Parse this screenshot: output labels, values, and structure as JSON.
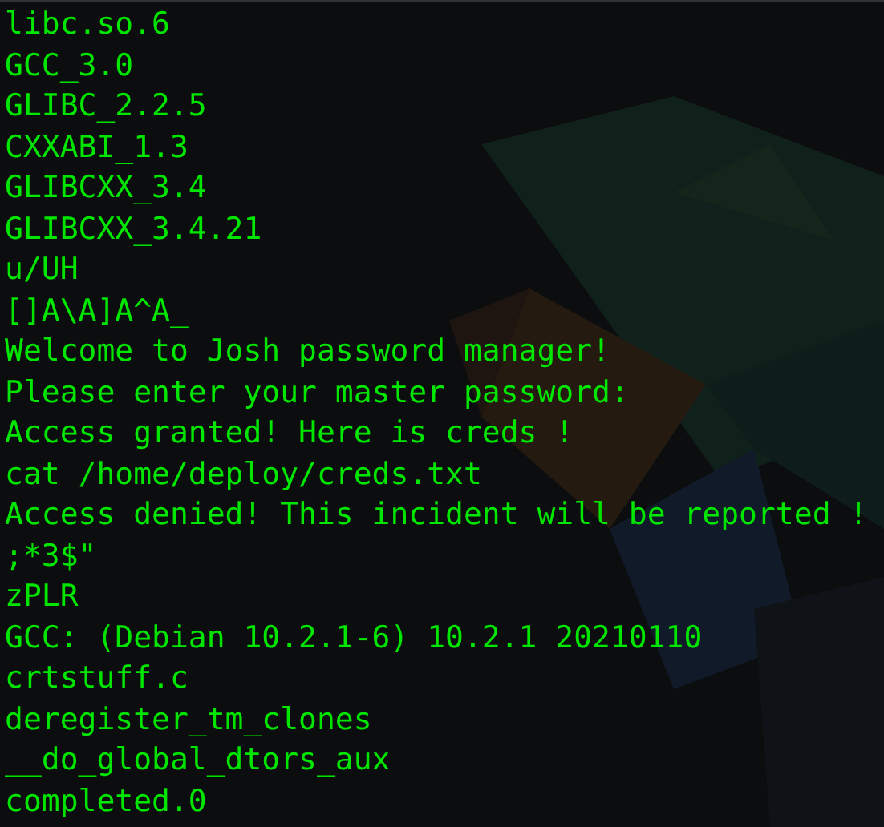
{
  "terminal": {
    "lines": [
      "libc.so.6",
      "GCC_3.0",
      "GLIBC_2.2.5",
      "CXXABI_1.3",
      "GLIBCXX_3.4",
      "GLIBCXX_3.4.21",
      "u/UH",
      "[]A\\A]A^A_",
      "Welcome to Josh password manager!",
      "Please enter your master password:",
      "Access granted! Here is creds !",
      "cat /home/deploy/creds.txt",
      "Access denied! This incident will be reported !",
      ";*3$\"",
      "zPLR",
      "GCC: (Debian 10.2.1-6) 10.2.1 20210110",
      "crtstuff.c",
      "deregister_tm_clones",
      "__do_global_dtors_aux",
      "completed.0"
    ]
  }
}
